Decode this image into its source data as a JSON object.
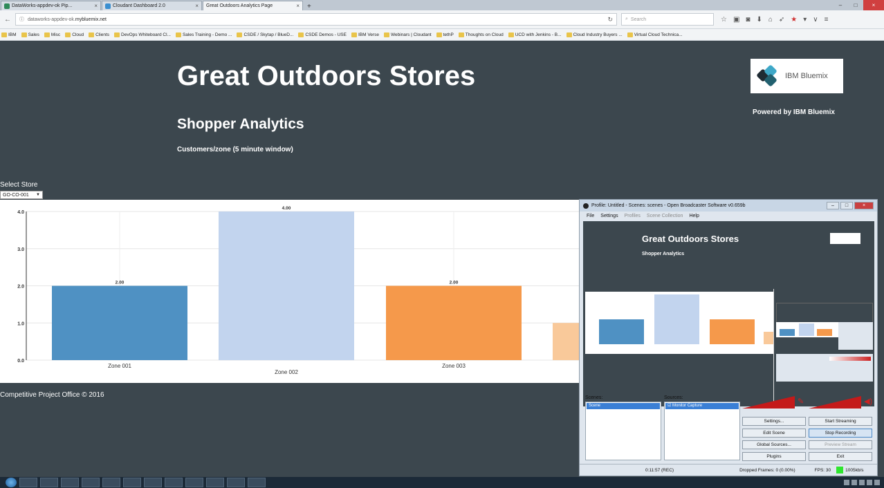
{
  "browser": {
    "tabs": [
      {
        "label": "DataWorks-appdev-ok Pip...",
        "active": false,
        "icon": "dataworks-icon"
      },
      {
        "label": "Cloudant Dashboard 2.0",
        "active": false,
        "icon": "cloudant-icon"
      },
      {
        "label": "Great Outdoors Analytics Page",
        "active": true,
        "icon": ""
      }
    ],
    "url_prefix": "dataworks-appdev-ok.",
    "url_domain": "mybluemix.net",
    "search_placeholder": "Search",
    "bookmarks": [
      "IBM",
      "Sales",
      "Misc",
      "Cloud",
      "Clients",
      "DevOps Whiteboard Cl...",
      "Sales Training - Demo ...",
      "CSDE / Skytap / BlueD...",
      "CSDE Demos - USE",
      "IBM Verse",
      "Webinars | Cloudant",
      "tethP",
      "Thoughts on Cloud",
      "UCD with Jenkins - B...",
      "Cloud Industry Buyers ...",
      "Virtual Cloud Technica..."
    ]
  },
  "header": {
    "title": "Great Outdoors Stores",
    "subtitle": "Shopper Analytics",
    "caption": "Customers/zone (5 minute window)",
    "logo_text": "IBM Bluemix",
    "powered_by": "Powered by IBM Bluemix"
  },
  "store_select": {
    "label": "Select Store",
    "value": "GO-CO-001"
  },
  "chart_data": {
    "type": "bar",
    "categories": [
      "Zone 001",
      "Zone 002",
      "Zone 003",
      ""
    ],
    "values": [
      2.0,
      4.0,
      2.0,
      1.0
    ],
    "value_labels": [
      "2.00",
      "4.00",
      "2.00",
      ""
    ],
    "yticks": [
      "0.0",
      "1.0",
      "2.0",
      "3.0",
      "4.0"
    ],
    "ylim": [
      0,
      4
    ],
    "colors": [
      "#4f91c3",
      "#c2d4ee",
      "#f5994b",
      "#f9c99a"
    ],
    "grid": true
  },
  "footer": {
    "text": "Competitive Project Office © 2016"
  },
  "obs": {
    "title": "Profile: Untitled - Scenes: scenes - Open Broadcaster Software v0.659b",
    "menu": [
      "File",
      "Settings",
      "Profiles",
      "Scene Collection",
      "Help"
    ],
    "preview_title": "Great Outdoors Stores",
    "preview_subtitle": "Shopper Analytics",
    "scenes_label": "Scenes:",
    "scenes": [
      "Scene"
    ],
    "sources_label": "Sources:",
    "sources": [
      "Monitor Capture"
    ],
    "buttons": {
      "settings": "Settings...",
      "edit_scene": "Edit Scene",
      "global_sources": "Global Sources...",
      "plugins": "Plugins",
      "start_streaming": "Start Streaming",
      "stop_recording": "Stop Recording",
      "preview_stream": "Preview Stream",
      "exit": "Exit"
    },
    "status": {
      "time": "0:11:57 (REC)",
      "dropped": "Dropped Frames: 0 (0.00%)",
      "fps": "FPS: 30",
      "bitrate": "1005kb/s"
    }
  }
}
